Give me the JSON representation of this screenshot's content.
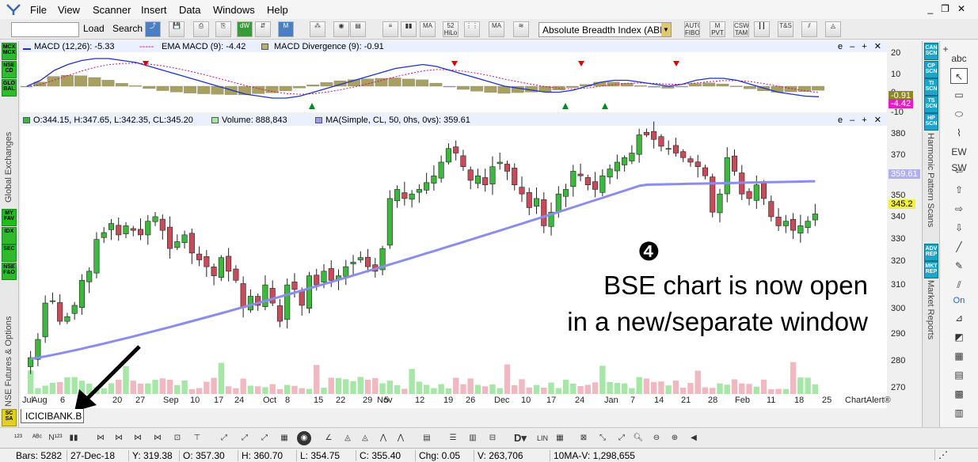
{
  "menu": [
    "File",
    "View",
    "Scanner",
    "Insert",
    "Data",
    "Windows",
    "Help"
  ],
  "toolbar": {
    "symbol_value": "",
    "load_label": "Load",
    "search_label": "Search",
    "indicator_selected": "Absolute Breadth Index (ABI"
  },
  "left_sidebar": {
    "buttons_top": [
      "MCX MCX",
      "NSE CD",
      "GLO BAL"
    ],
    "label_top": "Global Exchanges",
    "buttons_bottom": [
      "MY FAV",
      "IDX",
      "SEC",
      "NSE F&O"
    ],
    "label_bottom": "NSE Futures & Options",
    "sc_button": "SC SA"
  },
  "right_sidebar": {
    "buttons_top": [
      "CAN SCN",
      "CP SCN",
      "TI SCN",
      "TS SCN",
      "HP SCN"
    ],
    "label_top": "Harmonic Pattern Scans",
    "buttons_bottom": [
      "ADV REP",
      "MKT REP"
    ],
    "label_bottom": "Market Reports"
  },
  "tools": {
    "abc_label": "abc",
    "sw_label": "EW SW",
    "on_label": "On"
  },
  "macd_panel": {
    "macd_label": "MACD (12,26): -5.33",
    "ema_label": "EMA MACD (9): -4.42",
    "divergence_label": "MACD Divergence (9): -0.91",
    "axis": [
      "20",
      "10",
      "0",
      "-10"
    ],
    "tag_divergence": "-0.91",
    "tag_ema": "-4.42"
  },
  "price_panel": {
    "ohlc_label": "O:344.15, H:347.65, L:342.35, CL:345.20",
    "volume_label": "Volume: 888,843",
    "ma_label": "MA(Simple, CL, 50, 0hs, 0vs): 359.61",
    "axis": [
      "380",
      "370",
      "360",
      "350",
      "340",
      "330",
      "320",
      "310",
      "300",
      "290",
      "280",
      "270"
    ],
    "tag_ma": "359.61",
    "tag_close": "345.2"
  },
  "x_axis": [
    "Jul",
    "Aug",
    "6",
    "20",
    "27",
    "Sep",
    "10",
    "17",
    "24",
    "Oct",
    "8",
    "15",
    "22",
    "29",
    "Nov",
    "5",
    "12",
    "19",
    "26",
    "Dec",
    "10",
    "17",
    "24",
    "Jan",
    "7",
    "14",
    "21",
    "28",
    "Feb",
    "11",
    "18",
    "25"
  ],
  "watermark": "ChartAlert®",
  "annotation": {
    "number": "❹",
    "line1": "BSE chart is now open",
    "line2": "in a new/separate window"
  },
  "symbol_tab": "ICICIBANK.B",
  "status": {
    "bars": "Bars: 5282",
    "date": "27-Dec-18",
    "y": "Y: 319.38",
    "o": "O: 357.30",
    "h": "H: 360.70",
    "l": "L: 354.75",
    "c": "C: 355.40",
    "chg": "Chg: 0.05",
    "v": "V: 263,706",
    "ma": "10MA-V: 1,298,655"
  },
  "colors": {
    "up_candle": "#3cb83c",
    "down_candle": "#c84b5a",
    "ma_line": "#8c8cf0",
    "macd_line": "#2030c8",
    "ema_line": "#d01070",
    "divergence": "#a8a060",
    "up_volume": "#a6e6a6",
    "down_volume": "#f0b8c0"
  },
  "chart_data": {
    "type": "candlestick",
    "ylim": [
      266,
      384
    ],
    "close": [
      282,
      290,
      306,
      307,
      298,
      300,
      305,
      316,
      320,
      334,
      337,
      341,
      336,
      340,
      338,
      336,
      342,
      344,
      338,
      330,
      333,
      336,
      328,
      325,
      322,
      318,
      326,
      320,
      316,
      304,
      309,
      305,
      314,
      306,
      298,
      314,
      312,
      305,
      318,
      314,
      320,
      316,
      318,
      322,
      324,
      326,
      322,
      320,
      330,
      352,
      356,
      352,
      354,
      356,
      359,
      362,
      368,
      374,
      372,
      366,
      360,
      362,
      358,
      366,
      368,
      364,
      358,
      354,
      348,
      352,
      340,
      346,
      354,
      356,
      364,
      362,
      358,
      356,
      362,
      365,
      368,
      370,
      372,
      380,
      380,
      378,
      375,
      374,
      372,
      370,
      368,
      366,
      362,
      346,
      354,
      370,
      364,
      354,
      352,
      358,
      352,
      344,
      340,
      342,
      338,
      340,
      342,
      345.2
    ],
    "ma50_start": 281.5,
    "ma50_end": 359.6,
    "macd": [
      0,
      3,
      8,
      11,
      13,
      14,
      14,
      13,
      12,
      10,
      8,
      6,
      4,
      2,
      0,
      -2,
      -4,
      -5,
      -6,
      -6,
      -5,
      -3,
      -1,
      1,
      3,
      5,
      7,
      9,
      10,
      11,
      10,
      8,
      6,
      4,
      2,
      0,
      -1,
      -2,
      -3,
      -3,
      -2,
      0,
      2,
      3,
      3,
      2,
      1,
      0,
      1,
      3,
      4,
      4,
      3,
      1,
      -1,
      -3,
      -4,
      -5,
      -5.3
    ],
    "macd_axis": [
      20,
      10,
      0,
      -10
    ]
  }
}
